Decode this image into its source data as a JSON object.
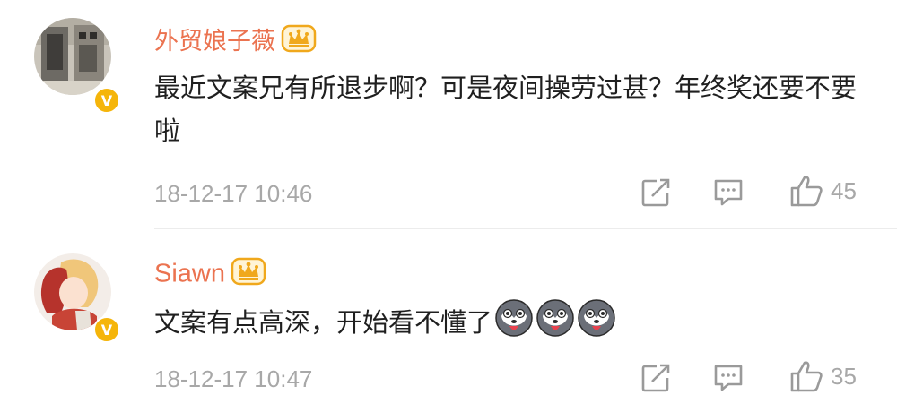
{
  "comments": [
    {
      "username": "外贸娘子薇",
      "text": "最近文案兄有所退步啊？可是夜间操劳过甚？年终奖还要不要啦",
      "timestamp": "18-12-17 10:46",
      "likes": "45",
      "verified_badge": "V",
      "icons": [
        "crown-icon",
        "share-icon",
        "comment-icon",
        "like-icon"
      ]
    },
    {
      "username": "Siawn",
      "text": "文案有点高深，开始看不懂了",
      "timestamp": "18-12-17 10:47",
      "likes": "35",
      "verified_badge": "V",
      "emoji_count": 3,
      "icons": [
        "crown-icon",
        "husky-emoji-icon",
        "share-icon",
        "comment-icon",
        "like-icon"
      ]
    }
  ],
  "colors": {
    "username": "#eb7350",
    "text": "#1f1f1f",
    "meta": "#a8a8a8",
    "badge": "#f5b50a",
    "crown": "#f0a81c"
  }
}
